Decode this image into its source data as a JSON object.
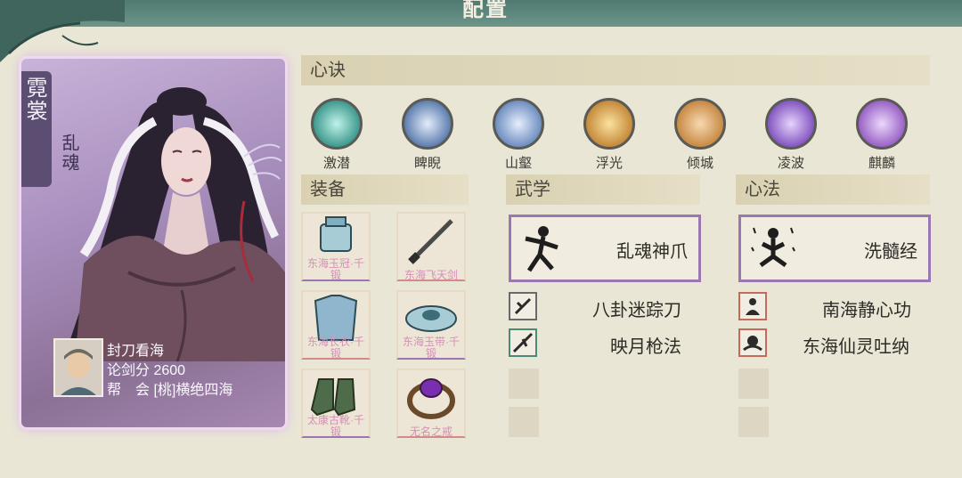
{
  "header": {
    "title": "配置"
  },
  "character": {
    "name": "霓裳",
    "title": "乱魂",
    "player_name": "封刀看海",
    "score_label": "论剑分",
    "score": "2600",
    "guild_label": "帮　会",
    "guild": "[桃]横绝四海"
  },
  "xinjue": {
    "header": "心诀",
    "items": [
      {
        "label": "激潜",
        "color": "#3f9a8e"
      },
      {
        "label": "睥睨",
        "color": "#5f7fb0"
      },
      {
        "label": "山壑",
        "color": "#6f8fc0"
      },
      {
        "label": "浮光",
        "color": "#c58a3a"
      },
      {
        "label": "倾城",
        "color": "#c88a45"
      },
      {
        "label": "凌波",
        "color": "#8457c2"
      },
      {
        "label": "麒麟",
        "color": "#9a62c6"
      }
    ]
  },
  "equipment": {
    "header": "装备",
    "items": [
      {
        "name": "东海玉冠·千锻",
        "icon": "crown-icon"
      },
      {
        "name": "东海飞天剑",
        "icon": "sword-icon"
      },
      {
        "name": "东海长衣·千锻",
        "icon": "robe-icon"
      },
      {
        "name": "东海玉带·千锻",
        "icon": "belt-icon"
      },
      {
        "name": "太康古靴·千锻",
        "icon": "boots-icon"
      },
      {
        "name": "无名之戒",
        "icon": "ring-icon"
      }
    ]
  },
  "wuxue": {
    "header": "武学",
    "main": "乱魂神爪",
    "subs": [
      "八卦迷踪刀",
      "映月枪法"
    ]
  },
  "xinfa": {
    "header": "心法",
    "main": "洗髓经",
    "subs": [
      "南海静心功",
      "东海仙灵吐纳"
    ]
  }
}
